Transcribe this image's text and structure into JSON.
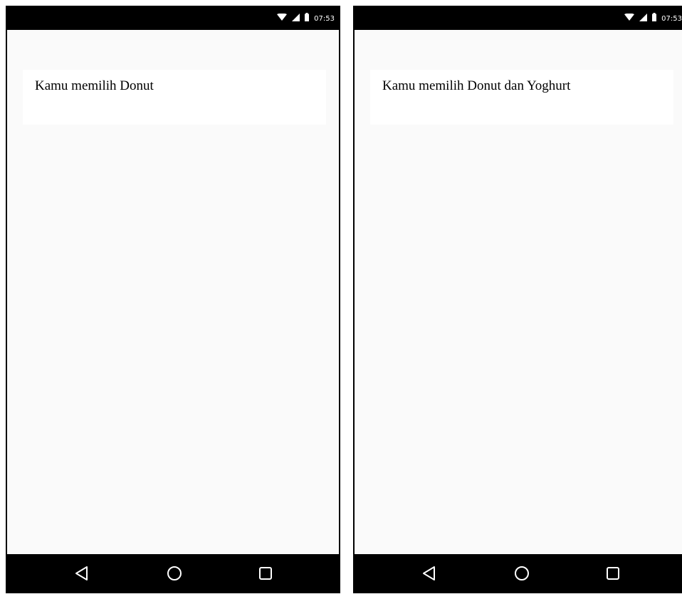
{
  "screens": [
    {
      "status_bar": {
        "time": "07:53",
        "icons": [
          "wifi-icon",
          "signal-icon",
          "battery-icon"
        ]
      },
      "message": "Kamu memilih Donut",
      "nav": [
        "back-icon",
        "home-icon",
        "recents-icon"
      ]
    },
    {
      "status_bar": {
        "time": "07:53",
        "icons": [
          "wifi-icon",
          "signal-icon",
          "battery-icon"
        ]
      },
      "message": "Kamu memilih Donut dan Yoghurt",
      "nav": [
        "back-icon",
        "home-icon",
        "recents-icon"
      ]
    }
  ],
  "colors": {
    "bar_background": "#000000",
    "screen_background": "#fafafa",
    "card_background": "#ffffff",
    "icon_color": "#ffffff"
  }
}
